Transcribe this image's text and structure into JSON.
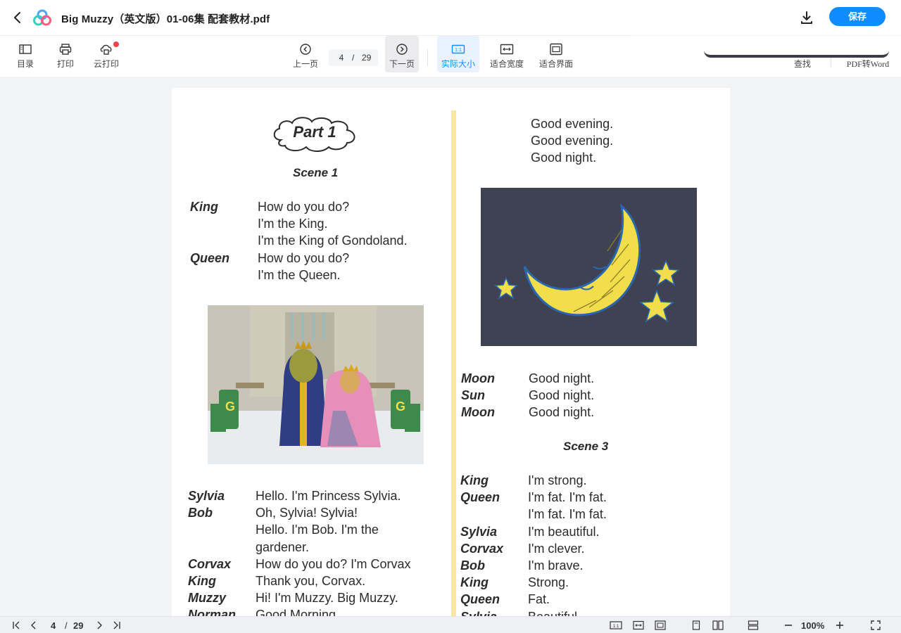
{
  "title_bar": {
    "document_title": "Big Muzzy（英文版）01-06集 配套教材.pdf",
    "save_label": "保存"
  },
  "toolbar": {
    "toc": "目录",
    "print": "打印",
    "cloud_print": "云打印",
    "prev_page": "上一页",
    "current_page": "4",
    "page_separator": "/",
    "total_pages": "29",
    "next_page": "下一页",
    "actual_size": "实际大小",
    "fit_width": "适合宽度",
    "fit_screen": "适合界面",
    "find": "查找",
    "pdf_to_word": "PDF转Word"
  },
  "document_page": {
    "part_title": "Part 1",
    "scene1_title": "Scene 1",
    "scene3_title": "Scene 3",
    "block1": [
      {
        "speaker": "King",
        "line": "How do you do?"
      },
      {
        "speaker": "",
        "line": "I'm the King."
      },
      {
        "speaker": "",
        "line": "I'm the King of Gondoland."
      },
      {
        "speaker": "Queen",
        "line": "How do you do?"
      },
      {
        "speaker": "",
        "line": "I'm the Queen."
      }
    ],
    "block2": [
      {
        "speaker": "Sylvia",
        "line": "Hello. I'm Princess Sylvia."
      },
      {
        "speaker": "Bob",
        "line": "Oh, Sylvia! Sylvia!"
      },
      {
        "speaker": "",
        "line": "Hello. I'm Bob. I'm the"
      },
      {
        "speaker": "",
        "line": "gardener."
      },
      {
        "speaker": "Corvax",
        "line": "How do you do? I'm Corvax"
      },
      {
        "speaker": "King",
        "line": "Thank you, Corvax."
      },
      {
        "speaker": "Muzzy",
        "line": "Hi! I'm Muzzy. Big Muzzy."
      },
      {
        "speaker": "Norman",
        "line": "Good Morning."
      }
    ],
    "right_top": [
      "Good evening.",
      "Good evening.",
      "Good night."
    ],
    "block3": [
      {
        "speaker": "Moon",
        "line": "Good night."
      },
      {
        "speaker": "Sun",
        "line": "Good night."
      },
      {
        "speaker": "Moon",
        "line": "Good night."
      }
    ],
    "block4": [
      {
        "speaker": "King",
        "line": "I'm strong."
      },
      {
        "speaker": "Queen",
        "line": "I'm fat. I'm fat."
      },
      {
        "speaker": "",
        "line": "I'm fat. I'm fat."
      },
      {
        "speaker": "Sylvia",
        "line": "I'm beautiful."
      },
      {
        "speaker": "Corvax",
        "line": "I'm clever."
      },
      {
        "speaker": "Bob",
        "line": "I'm brave."
      },
      {
        "speaker": "King",
        "line": "Strong."
      },
      {
        "speaker": "Queen",
        "line": "Fat."
      },
      {
        "speaker": "Sylvia",
        "line": "Beautiful."
      }
    ]
  },
  "status_bar": {
    "current_page": "4",
    "page_separator": "/",
    "total_pages": "29",
    "zoom_level": "100%"
  },
  "colors": {
    "accent": "#0f8cff",
    "notification_dot": "#f5424d",
    "night_sky": "#3e4253",
    "moon_yellow": "#f2dd4a"
  }
}
